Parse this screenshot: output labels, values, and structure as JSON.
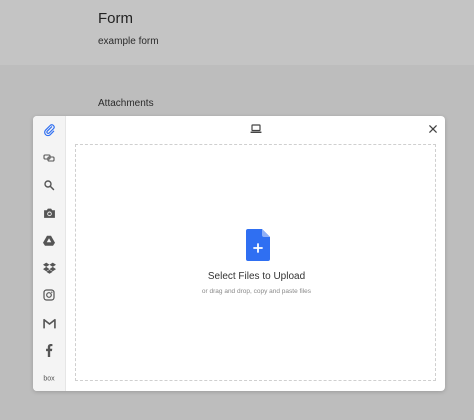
{
  "form": {
    "title": "Form",
    "subtitle": "example form",
    "attachments_label": "Attachments"
  },
  "picker": {
    "sources": [
      {
        "name": "My Device",
        "icon": "paperclip-icon",
        "active": true
      },
      {
        "name": "Link",
        "icon": "link-icon",
        "active": false
      },
      {
        "name": "Web Search",
        "icon": "search-icon",
        "active": false
      },
      {
        "name": "Camera",
        "icon": "camera-icon",
        "active": false
      },
      {
        "name": "Google Drive",
        "icon": "google-drive-icon",
        "active": false
      },
      {
        "name": "Dropbox",
        "icon": "dropbox-icon",
        "active": false
      },
      {
        "name": "Instagram",
        "icon": "instagram-icon",
        "active": false
      },
      {
        "name": "Gmail",
        "icon": "gmail-icon",
        "active": false
      },
      {
        "name": "Facebook",
        "icon": "facebook-icon",
        "active": false
      },
      {
        "name": "Box",
        "icon": "box-icon",
        "active": false,
        "label": "box"
      }
    ],
    "dropzone": {
      "title": "Select Files to Upload",
      "hint": "or drag and drop, copy and paste files"
    },
    "colors": {
      "accent": "#2f6ff2",
      "sidebar_bg": "#f4f4f4",
      "page_bg": "#bdbdbd"
    }
  }
}
